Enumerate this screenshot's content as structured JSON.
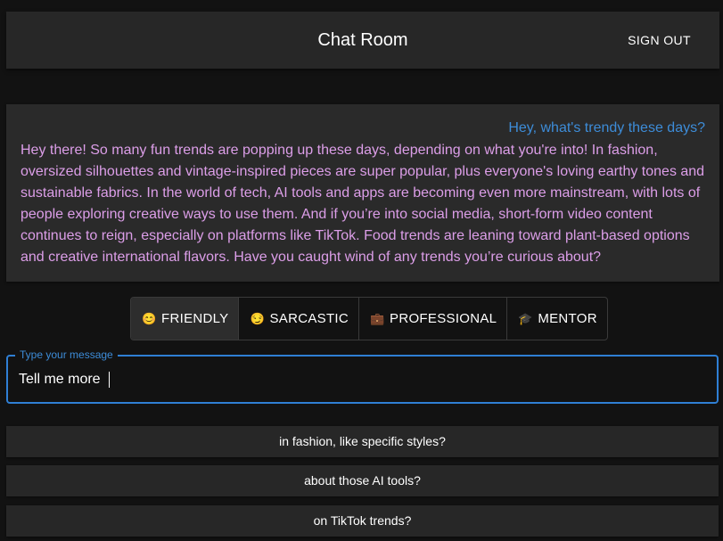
{
  "header": {
    "title": "Chat Room",
    "sign_out_label": "SIGN OUT"
  },
  "chat": {
    "user_message": "Hey, what's trendy these days?",
    "bot_message": "Hey there! So many fun trends are popping up these days, depending on what you're into! In fashion, oversized silhouettes and vintage-inspired pieces are super popular, plus everyone's loving earthy tones and sustainable fabrics. In the world of tech, AI tools and apps are becoming even more mainstream, with lots of people exploring creative ways to use them. And if you’re into social media, short-form video content continues to reign, especially on platforms like TikTok. Food trends are leaning toward plant-based options and creative international flavors. Have you caught wind of any trends you’re curious about?"
  },
  "tones": [
    {
      "icon": "😊",
      "icon_name": "smiling-face-icon",
      "label": "FRIENDLY",
      "selected": true
    },
    {
      "icon": "😏",
      "icon_name": "smirking-face-icon",
      "label": "SARCASTIC",
      "selected": false
    },
    {
      "icon": "💼",
      "icon_name": "briefcase-icon",
      "label": "PROFESSIONAL",
      "selected": false
    },
    {
      "icon": "🎓",
      "icon_name": "graduation-cap-icon",
      "label": "MENTOR",
      "selected": false
    }
  ],
  "input": {
    "label": "Type your message",
    "value": "Tell me more"
  },
  "suggestions": [
    "in fashion, like specific styles?",
    "about those AI tools?",
    "on TikTok trends?"
  ],
  "colors": {
    "background": "#121212",
    "user_message": "#3d8cd8",
    "bot_message": "#dc9ee8",
    "accent": "#2f7fd4"
  }
}
